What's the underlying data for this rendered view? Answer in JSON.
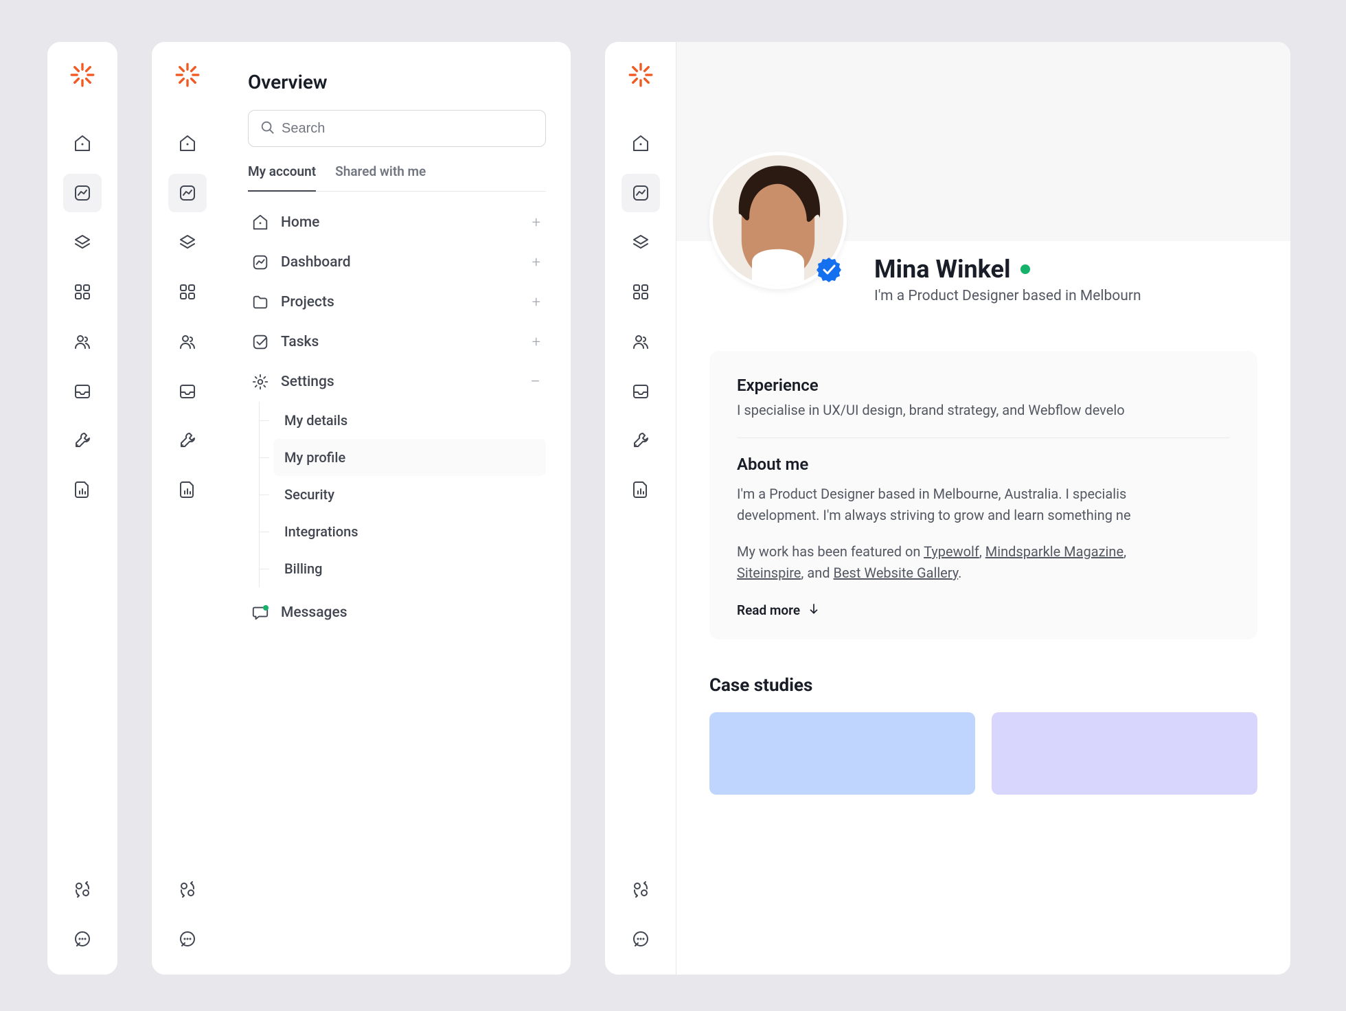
{
  "logo_name": "sunburst-logo",
  "colors": {
    "accent": "#F15A22",
    "success": "#17B26A",
    "verify": "#1570EF"
  },
  "rail_icons": [
    {
      "name": "home-icon"
    },
    {
      "name": "chart-icon",
      "active": true
    },
    {
      "name": "layers-icon"
    },
    {
      "name": "grid-icon"
    },
    {
      "name": "users-icon"
    },
    {
      "name": "inbox-icon"
    },
    {
      "name": "tools-icon"
    },
    {
      "name": "file-chart-icon"
    }
  ],
  "rail_bottom": [
    {
      "name": "swap-icon"
    },
    {
      "name": "chat-icon"
    }
  ],
  "overview": {
    "title": "Overview",
    "search_placeholder": "Search",
    "tabs": [
      {
        "label": "My account",
        "active": true
      },
      {
        "label": "Shared with me",
        "active": false
      }
    ],
    "items": [
      {
        "icon": "home-icon",
        "label": "Home",
        "action": "plus"
      },
      {
        "icon": "chart-icon",
        "label": "Dashboard",
        "action": "plus"
      },
      {
        "icon": "folder-icon",
        "label": "Projects",
        "action": "plus"
      },
      {
        "icon": "check-square-icon",
        "label": "Tasks",
        "action": "plus"
      },
      {
        "icon": "gear-icon",
        "label": "Settings",
        "action": "minus",
        "children": [
          {
            "label": "My details"
          },
          {
            "label": "My profile",
            "active": true
          },
          {
            "label": "Security"
          },
          {
            "label": "Integrations"
          },
          {
            "label": "Billing"
          }
        ]
      },
      {
        "icon": "message-icon",
        "label": "Messages",
        "badge": true
      }
    ]
  },
  "profile": {
    "name": "Mina Winkel",
    "status": "online",
    "tagline": "I'm a Product Designer based in Melbourn",
    "experience": {
      "heading": "Experience",
      "text": "I specialise in UX/UI design, brand strategy, and Webflow develo"
    },
    "about": {
      "heading": "About me",
      "line1": "I'm a Product Designer based in Melbourne, Australia. I specialis",
      "line2": "development. I'm always striving to grow and learn something ne",
      "line3_prefix": "My work has been featured on ",
      "links": [
        "Typewolf",
        "Mindsparkle Magazine",
        "Siteinspire",
        "Best Website Gallery"
      ],
      "line4_joiner": ", and ",
      "period": "."
    },
    "readmore": "Read more",
    "case_studies_heading": "Case studies"
  }
}
